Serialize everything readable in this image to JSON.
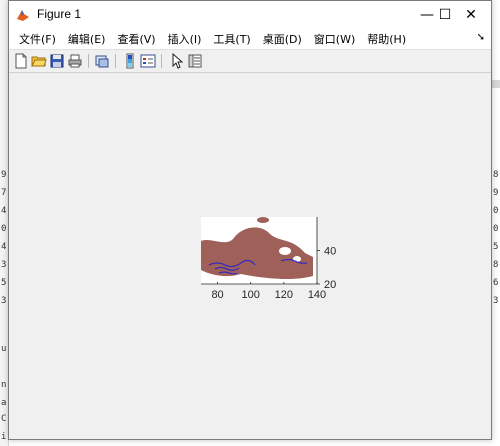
{
  "window": {
    "title": "Figure 1",
    "minimize": "—",
    "maximize": "☐",
    "close": "✕"
  },
  "menu": [
    {
      "label": "文件(F)"
    },
    {
      "label": "编辑(E)"
    },
    {
      "label": "查看(V)"
    },
    {
      "label": "插入(I)"
    },
    {
      "label": "工具(T)"
    },
    {
      "label": "桌面(D)"
    },
    {
      "label": "窗口(W)"
    },
    {
      "label": "帮助(H)"
    }
  ],
  "toolbar": {
    "icons": [
      "new-figure-icon",
      "open-file-icon",
      "save-icon",
      "print-icon",
      "link-plot-icon",
      "colorbar-icon",
      "legend-icon",
      "pointer-icon",
      "property-editor-icon"
    ]
  },
  "chart_data": {
    "type": "area",
    "title": "",
    "xlabel": "",
    "ylabel": "",
    "xlim": [
      70,
      140
    ],
    "ylim": [
      20,
      60
    ],
    "xticks": [
      "80",
      "100",
      "120",
      "140"
    ],
    "yticks": [
      "20",
      "40"
    ],
    "fill_color": "#a0605a",
    "contour_color": "#2222cc",
    "description_series": [
      {
        "values": [
          [
            70,
            45
          ],
          [
            80,
            46
          ],
          [
            90,
            52
          ],
          [
            100,
            55
          ],
          [
            110,
            53
          ],
          [
            120,
            48
          ],
          [
            130,
            44
          ],
          [
            130,
            28
          ],
          [
            110,
            25
          ],
          [
            95,
            24
          ],
          [
            80,
            22
          ],
          [
            70,
            25
          ]
        ]
      }
    ]
  },
  "background": {
    "left_chars": [
      "9",
      "7",
      "4",
      "0",
      "4",
      "3",
      "5",
      "3",
      "u",
      "n",
      "a",
      "C",
      "i"
    ],
    "right_chars": [
      "8",
      "9",
      "0",
      "0",
      "5",
      "8",
      "6",
      "3"
    ]
  }
}
